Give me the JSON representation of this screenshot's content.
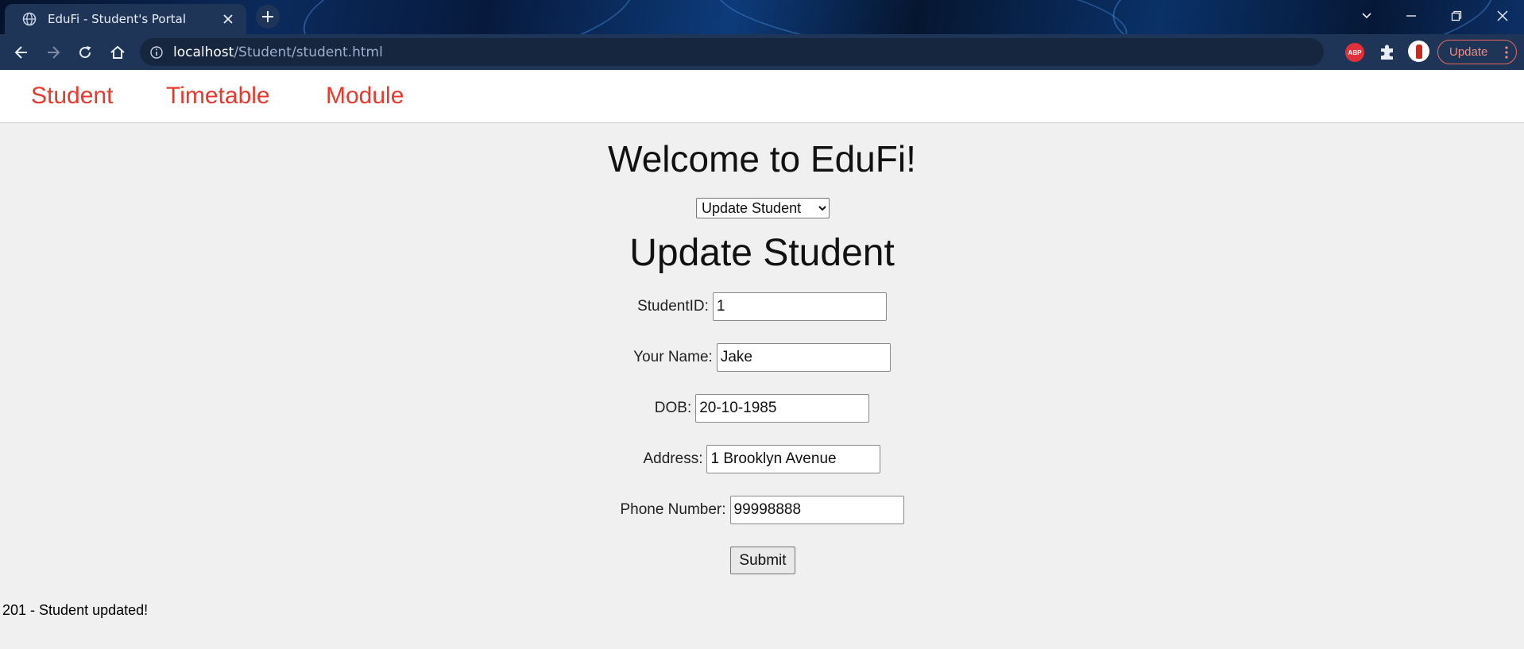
{
  "browser": {
    "tab_title": "EduFi - Student's Portal",
    "url_host": "localhost",
    "url_path": "/Student/student.html",
    "update_label": "Update",
    "extension_abp_label": "ABP"
  },
  "nav": {
    "items": [
      "Student",
      "Timetable",
      "Module"
    ],
    "color": "#e8392c"
  },
  "page": {
    "welcome": "Welcome to EduFi!",
    "mode_select": {
      "selected": "Update Student",
      "options": [
        "Update Student"
      ]
    },
    "form_title": "Update Student",
    "fields": [
      {
        "label": "StudentID:",
        "value": "1"
      },
      {
        "label": "Your Name:",
        "value": "Jake"
      },
      {
        "label": "DOB:",
        "value": "20-10-1985"
      },
      {
        "label": "Address:",
        "value": "1 Brooklyn Avenue"
      },
      {
        "label": "Phone Number:",
        "value": "99998888"
      }
    ],
    "submit_label": "Submit",
    "status_message": "201 - Student updated!"
  },
  "icons": {
    "tab": "globe-icon",
    "tab_close": "close-icon",
    "new_tab": "plus-icon",
    "back": "back-arrow-icon",
    "forward": "forward-arrow-icon",
    "reload": "reload-icon",
    "home": "home-icon",
    "site_info": "info-icon",
    "share": "share-icon",
    "bookmark": "star-icon",
    "extensions": "puzzle-icon",
    "menu": "kebab-menu-icon"
  }
}
